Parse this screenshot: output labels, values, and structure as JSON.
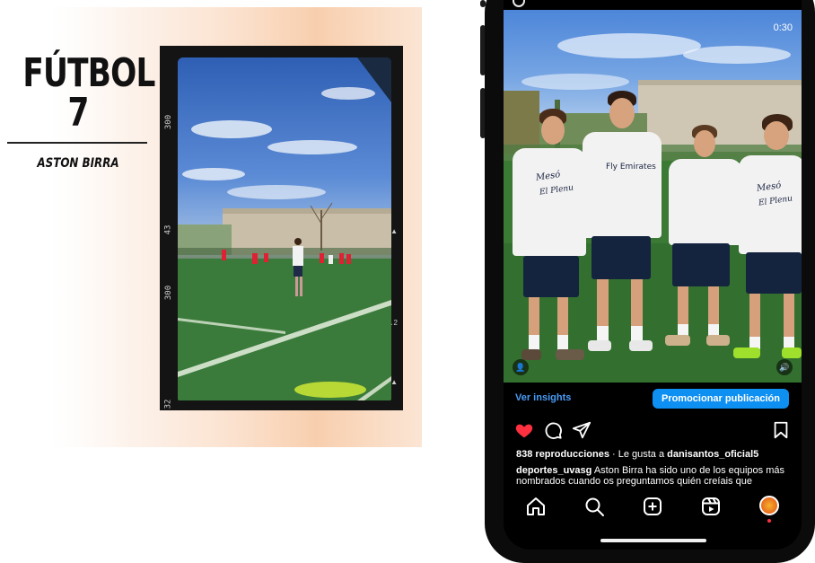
{
  "poster": {
    "title_line1": "FÚTBOL",
    "title_line2": "7",
    "subtitle": "ASTON BIRRA",
    "film_numbers": [
      "300",
      "43",
      "300",
      "32"
    ],
    "film_marks": [
      "▲",
      "▲2",
      "▲"
    ]
  },
  "post": {
    "video_timer": "0:30",
    "shirt_texts": [
      "Mesó",
      "El Plenu",
      "Fly Emirates",
      "Mesó",
      "El Plenu"
    ],
    "insights_label": "Ver insights",
    "promote_label": "Promocionar publicación",
    "views": "838 reproducciones",
    "liked_by_prefix": " · Le gusta a ",
    "liked_by_user": "danisantos_oficial5",
    "caption_user": "deportes_uvasg",
    "caption_text": " Aston Birra ha sido uno de los equipos más nombrados cuando os preguntamos quién creíais que",
    "accent_color": "#0e8ff2",
    "like_color": "#ff3040"
  },
  "icons": {
    "like": "heart-icon",
    "comment": "comment-icon",
    "share": "send-icon",
    "save": "bookmark-icon",
    "nav": [
      "home-icon",
      "search-icon",
      "create-icon",
      "reels-icon",
      "profile-avatar"
    ]
  }
}
